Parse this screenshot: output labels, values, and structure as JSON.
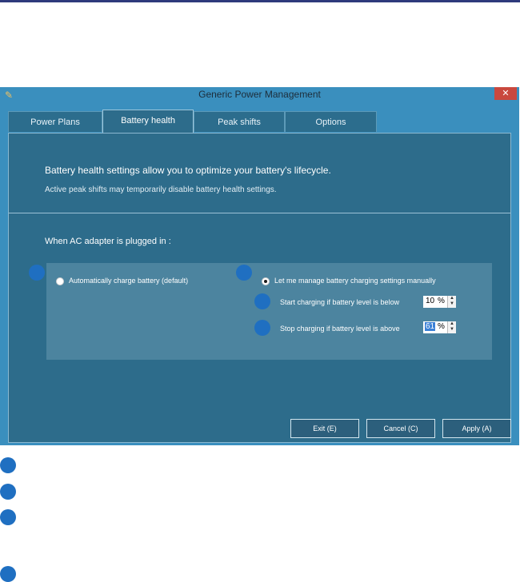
{
  "window": {
    "title": "Generic Power Management",
    "close_label": "✕",
    "app_icon": "power-plug-icon"
  },
  "tabs": [
    {
      "label": "Power Plans",
      "active": false
    },
    {
      "label": "Battery health",
      "active": true
    },
    {
      "label": "Peak shifts",
      "active": false
    },
    {
      "label": "Options",
      "active": false
    }
  ],
  "panel": {
    "intro_line1": "Battery health settings allow you to optimize your battery's lifecycle.",
    "intro_line2": "Active peak shifts may temporarily disable battery health settings.",
    "section_label": "When AC adapter is plugged in :"
  },
  "options": {
    "auto_label": "Automatically charge battery (default)",
    "manual_label": "Let me manage battery charging settings manually",
    "start_label": "Start charging if battery level is below",
    "start_value": "10",
    "stop_label": "Stop charging if battery level is above",
    "stop_value": "61",
    "unit": "%",
    "selected": "manual"
  },
  "buttons": {
    "exit": "Exit (E)",
    "cancel": "Cancel (C)",
    "apply": "Apply (A)"
  },
  "colors": {
    "window_frame": "#3a8fbe",
    "panel": "#2d6c8b",
    "marker": "#1f6fc1",
    "close": "#c9483e"
  }
}
